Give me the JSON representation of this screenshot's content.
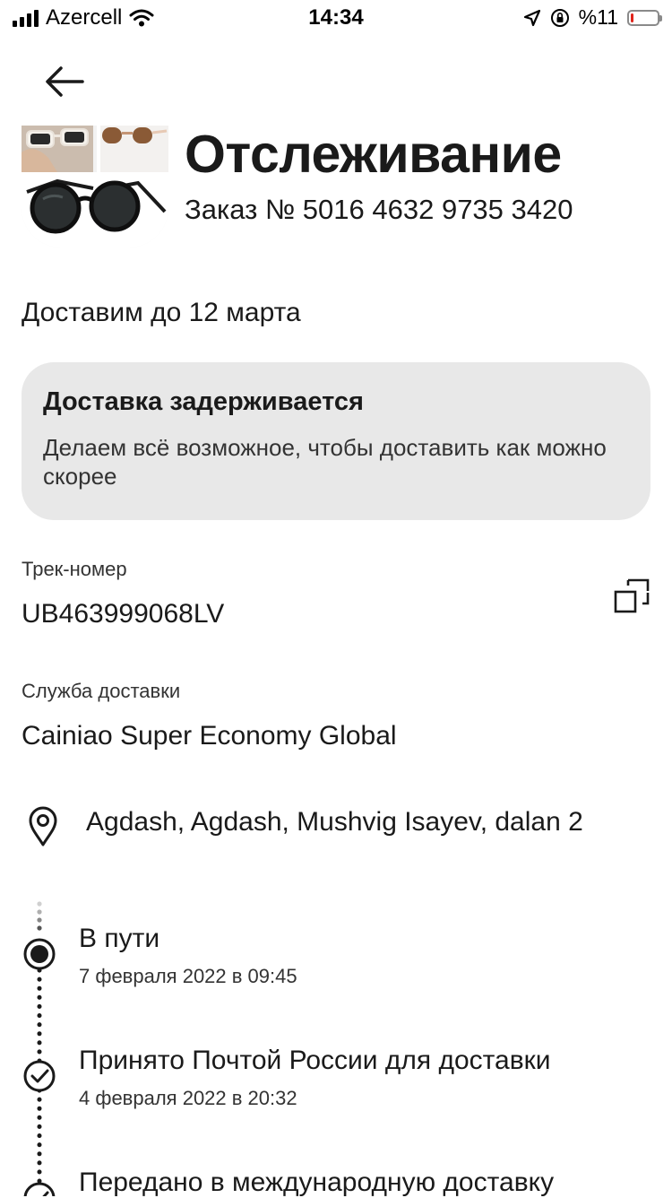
{
  "status_bar": {
    "carrier": "Azercell",
    "time": "14:34",
    "battery": "%11",
    "battery_level": 0.11,
    "battery_color": "#e0241b"
  },
  "header": {
    "back_icon": "arrow-left-icon",
    "title": "Отслеживание",
    "order": "Заказ № 5016 4632 9735 3420"
  },
  "delivery": {
    "estimate": "Доставим до 12 марта"
  },
  "delay_notice": {
    "title": "Доставка задерживается",
    "text": "Делаем всё возможное, чтобы доставить как можно скорее",
    "background": "#e8e8e8"
  },
  "tracking": {
    "label": "Трек-номер",
    "number": "UB463999068LV",
    "copy_icon": "copy-icon"
  },
  "carrier": {
    "label": "Служба доставки",
    "name": "Cainiao Super Economy Global"
  },
  "address": {
    "icon": "location-pin-icon",
    "text": "Agdash, Agdash, Mushvig Isayev, dalan 2"
  },
  "timeline": {
    "events": [
      {
        "title": "В пути",
        "date": "7 февраля 2022 в 09:45",
        "status": "current"
      },
      {
        "title": "Принято Почтой России для доставки",
        "date": "4 февраля 2022 в 20:32",
        "status": "done"
      },
      {
        "title": "Передано в международную доставку",
        "date": "",
        "status": "done"
      }
    ]
  }
}
